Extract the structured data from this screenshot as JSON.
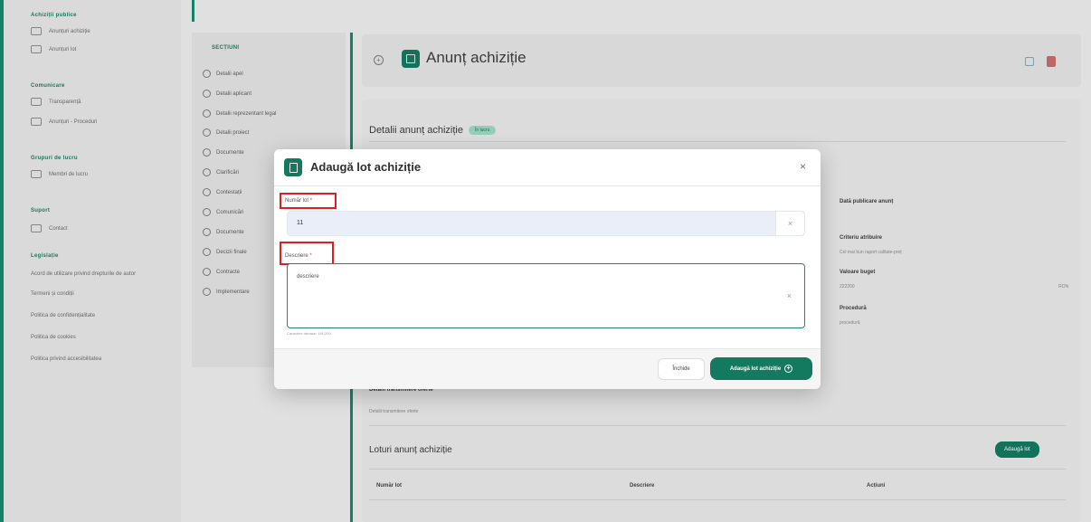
{
  "sidebar": {
    "groups": [
      {
        "heading": "Achiziții publice",
        "items": [
          "Anunțuri achiziție",
          "Anunțuri lot"
        ]
      },
      {
        "heading": "Comunicare",
        "items": [
          "Transparență",
          "Anunțuri - Proceduri"
        ]
      },
      {
        "heading": "Grupuri de lucru",
        "items": [
          "Membri de lucru"
        ]
      },
      {
        "heading": "Suport",
        "items": [
          "Contact"
        ]
      },
      {
        "heading": "Legislație",
        "links": [
          "Acord de utilizare privind drepturile de autor",
          "Termeni și condiții",
          "Politica de confidențialitate",
          "Politica de cookies",
          "Politica privind accesibilitatea"
        ]
      }
    ]
  },
  "secondary_nav": {
    "title": "SECȚIUNI",
    "items": [
      "Detalii apel",
      "Detalii aplicant",
      "Detalii reprezentant legal",
      "Detalii proiect",
      "Documente",
      "Clarificări",
      "Contestații",
      "Comunicări",
      "Documente",
      "Decizii finale",
      "Contracte",
      "Implementare"
    ]
  },
  "header": {
    "title": "Anunț achiziție"
  },
  "main": {
    "section_title": "Detalii anunț achiziție",
    "status_badge": "În lucru",
    "fields": [
      {
        "label": "Dată publicare anunț",
        "value": ""
      },
      {
        "label": "Criteriu atribuire",
        "value": "Cel mai bun raport calitate-preț"
      },
      {
        "label": "Valoare buget",
        "value": "222200"
      },
      {
        "label": "Procedură",
        "value": "procedură"
      }
    ],
    "currency": "RON",
    "offer_section_title": "Detalii transmitere oferte",
    "offer_section_text": "Detalii transmitere oferte",
    "lots_title": "Loturi anunț achiziție",
    "add_lot_button": "Adaugă lot",
    "table_headers": [
      "Număr lot",
      "Descriere",
      "Acțiuni"
    ]
  },
  "modal": {
    "title": "Adaugă lot achiziție",
    "close_glyph": "×",
    "lot_number_label": "Număr lot",
    "lot_number_value": "11",
    "description_label": "Descriere",
    "description_value": "descriere",
    "char_counter": "Caractere rămase: 191/200",
    "cancel_button": "Închide",
    "submit_button": "Adaugă lot achiziție",
    "clear_glyph": "×",
    "required_mark": "*"
  }
}
